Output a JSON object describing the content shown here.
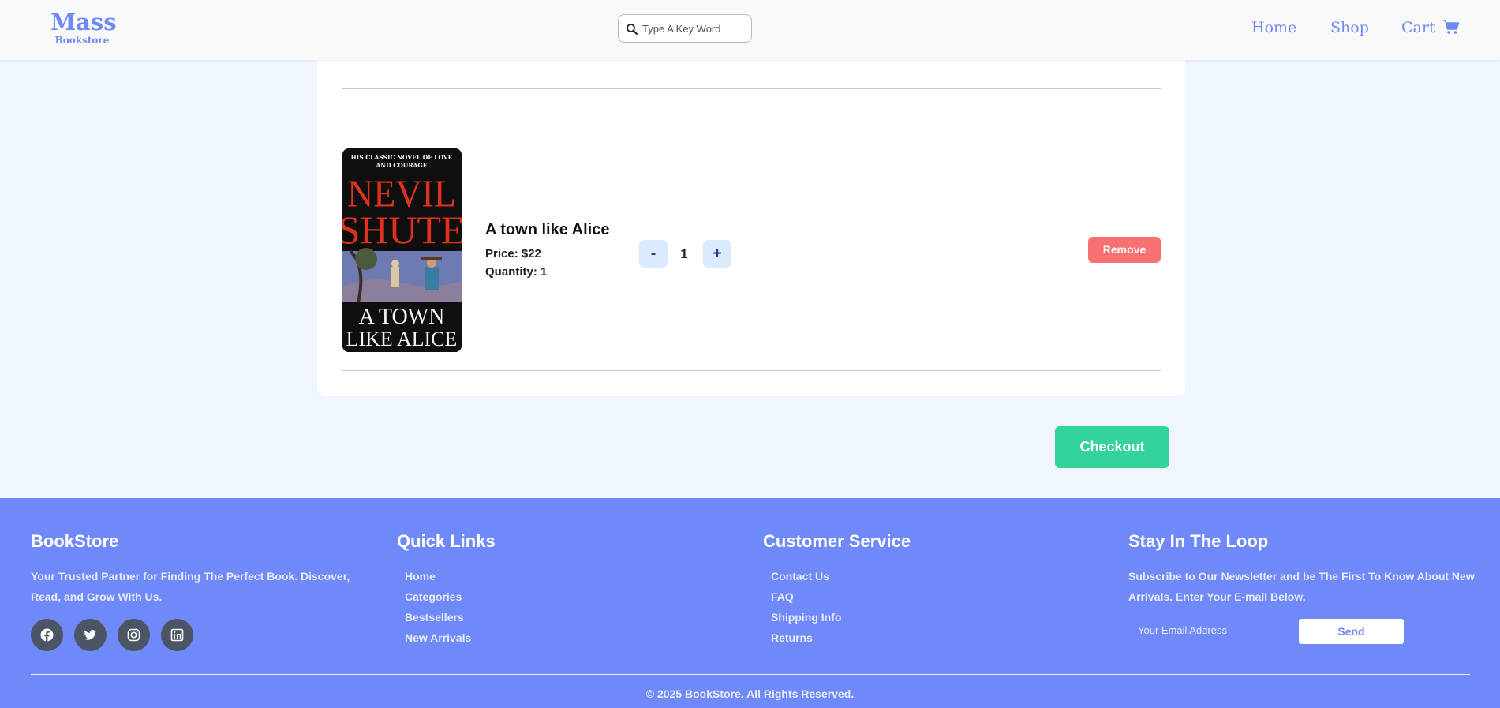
{
  "header": {
    "logo_main": "Mass",
    "logo_sub": "Bookstore",
    "search_placeholder": "Type A Key Word",
    "nav": {
      "home": "Home",
      "shop": "Shop",
      "cart": "Cart"
    }
  },
  "cart": {
    "items": [
      {
        "title": "A town like Alice",
        "price_text": "Price: $22",
        "quantity_text": "Quantity: 1",
        "quantity": "1",
        "minus_label": "-",
        "plus_label": "+",
        "remove_label": "Remove",
        "cover": {
          "tagline": "HIS CLASSIC NOVEL OF LOVE AND COURAGE",
          "author": [
            "NEVIL",
            "SHUTE"
          ],
          "title": [
            "A TOWN",
            "LIKE ALICE"
          ]
        }
      }
    ],
    "checkout_label": "Checkout"
  },
  "footer": {
    "about": {
      "title": "BookStore",
      "text": "Your Trusted Partner for Finding The Perfect Book. Discover, Read, and Grow With Us."
    },
    "quick_links": {
      "title": "Quick Links",
      "items": [
        "Home",
        "Categories",
        "Bestsellers",
        "New Arrivals"
      ]
    },
    "customer_service": {
      "title": "Customer Service",
      "items": [
        "Contact Us",
        "FAQ",
        "Shipping Info",
        "Returns"
      ]
    },
    "newsletter": {
      "title": "Stay In The Loop",
      "text": "Subscribe to Our Newsletter and be The First To Know About New Arrivals. Enter Your E-mail Below.",
      "email_placeholder": "Your Email Address",
      "send_label": "Send"
    },
    "socials": [
      "facebook-icon",
      "twitter-icon",
      "instagram-icon",
      "linkedin-icon"
    ],
    "copyright": "© 2025 BookStore. All Rights Reserved."
  },
  "colors": {
    "brand": "#6f89f9",
    "remove": "#f87171",
    "checkout": "#34d399",
    "qty_button": "#dbeafe"
  }
}
